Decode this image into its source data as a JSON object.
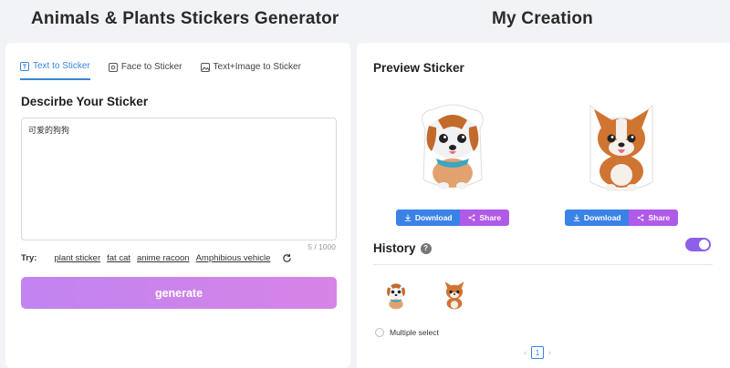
{
  "header": {
    "left_title": "Animals & Plants Stickers Generator",
    "right_title": "My Creation"
  },
  "tabs": [
    {
      "label": "Text to Sticker",
      "icon": "text-t-icon",
      "active": true
    },
    {
      "label": "Face to Sticker",
      "icon": "face-frame-icon",
      "active": false
    },
    {
      "label": "Text+Image to Sticker",
      "icon": "image-icon",
      "active": false
    }
  ],
  "describe": {
    "title": "Descirbe Your Sticker",
    "value": "可爱的狗狗",
    "char_count": "5 / 1000"
  },
  "try": {
    "label": "Try:",
    "suggestions": [
      "plant sticker",
      "fat cat",
      "anime racoon",
      "Amphibious vehicle"
    ]
  },
  "generate_label": "generate",
  "preview": {
    "title": "Preview Sticker",
    "download_label": "Download",
    "share_label": "Share"
  },
  "history": {
    "title": "History",
    "toggle_on": true,
    "multiple_select_label": "Multiple select",
    "page": "1"
  },
  "colors": {
    "accent_blue": "#3b82e6",
    "share_purple": "#b05ae8",
    "generate_gradient_start": "#c184f0",
    "toggle": "#8e5fe8"
  }
}
